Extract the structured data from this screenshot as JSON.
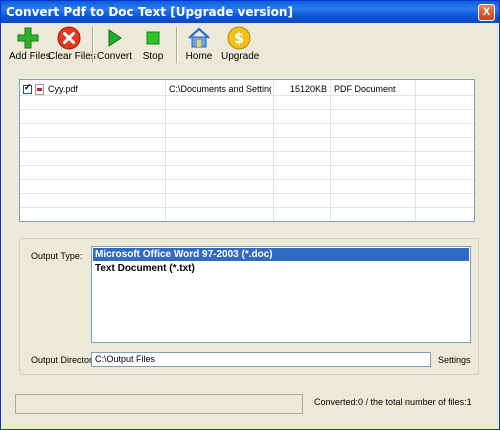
{
  "window": {
    "title": "Convert Pdf to Doc Text [Upgrade version]",
    "close_label": "X"
  },
  "toolbar": {
    "add_files": "Add Files",
    "clear_files": "Clear Files",
    "convert": "Convert",
    "stop": "Stop",
    "home": "Home",
    "upgrade": "Upgrade"
  },
  "files": [
    {
      "checked": true,
      "name": "Cyy.pdf",
      "path": "C:\\Documents and Setting...",
      "size": "15120KB",
      "type": "PDF Document"
    }
  ],
  "output": {
    "type_label": "Output Type:",
    "types": [
      "Microsoft Office Word 97-2003 (*.doc)",
      "Text Document (*.txt)"
    ],
    "selected_index": 0,
    "directory_label": "Output Directory:",
    "directory": "C:\\Output Files",
    "settings_label": "Settings"
  },
  "status": {
    "text": "Converted:0  /  the total number of files:1"
  },
  "colors": {
    "selection": "#316ac5",
    "titlebar": "#0a5fd8",
    "window_bg": "#ece9d8"
  }
}
